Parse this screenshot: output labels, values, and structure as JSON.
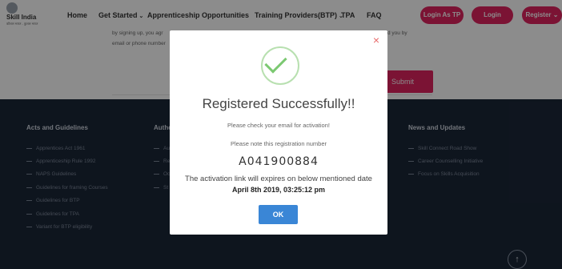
{
  "brand": {
    "name": "Skill India",
    "tagline": "कौशल भारत - कुशल भारत"
  },
  "nav": {
    "home": "Home",
    "get_started": "Get Started",
    "apprenticeship": "Apprenticeship Opportunities",
    "training_providers": "Training Providers(BTP)",
    "tpa": "TPA",
    "faq": "FAQ"
  },
  "buttons": {
    "login_tp": "Login As TP",
    "login": "Login",
    "register": "Register",
    "submit": "Submit"
  },
  "form": {
    "line1": "by signing up, you agr",
    "line1b": "d you by",
    "line2": "email or phone number"
  },
  "footer": {
    "col1_title": "Acts and Guidelines",
    "col1_items": [
      "Apprentices Act 1961",
      "Apprenticeship Rule 1992",
      "NAPS Guidelines",
      "Guidelines for framing Courses",
      "Guidelines for BTP",
      "Guidelines for TPA",
      "Variant for BTP eligibility"
    ],
    "col2_title": "Autho",
    "col2_items": [
      "Au",
      "Re",
      "Oc",
      "St"
    ],
    "col4_title": "News and Updates",
    "col4_items": [
      "Skill Connect Road Show",
      "Career Counselling Initiative",
      "Focus on Skills Acquisition"
    ]
  },
  "modal": {
    "title": "Registered Successfully!!",
    "check_email": "Please check your email for activation!",
    "note": "Please note this registration number",
    "registration_number": "A041900884",
    "expiry_text": "The activation link will expires on below mentioned date",
    "expiry_date": "April 8th 2019, 03:25:12 pm",
    "ok": "OK",
    "close_symbol": "×"
  },
  "colors": {
    "accent": "#e0235f",
    "footer_bg": "#1b2738",
    "ok_button": "#3a86d6",
    "success": "#7cc972"
  }
}
